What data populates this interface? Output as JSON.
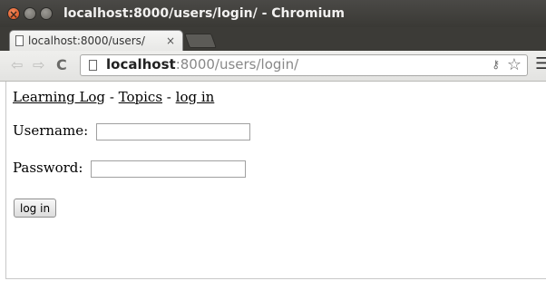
{
  "window": {
    "title": "localhost:8000/users/login/ - Chromium"
  },
  "tab": {
    "title": "localhost:8000/users/",
    "close": "×"
  },
  "toolbar": {
    "url_host": "localhost",
    "url_rest": ":8000/users/login/"
  },
  "nav": {
    "home_label": "Learning Log",
    "separator": " - ",
    "topics_label": "Topics",
    "login_label": "log in"
  },
  "form": {
    "username_label": "Username:",
    "username_value": "",
    "password_label": "Password:",
    "password_value": "",
    "submit_label": "log in"
  },
  "icons": {
    "back": "back-arrow-icon",
    "forward": "forward-arrow-icon",
    "reload": "reload-icon",
    "page": "page-icon",
    "key": "key-icon",
    "star": "star-icon",
    "menu": "menu-icon"
  }
}
